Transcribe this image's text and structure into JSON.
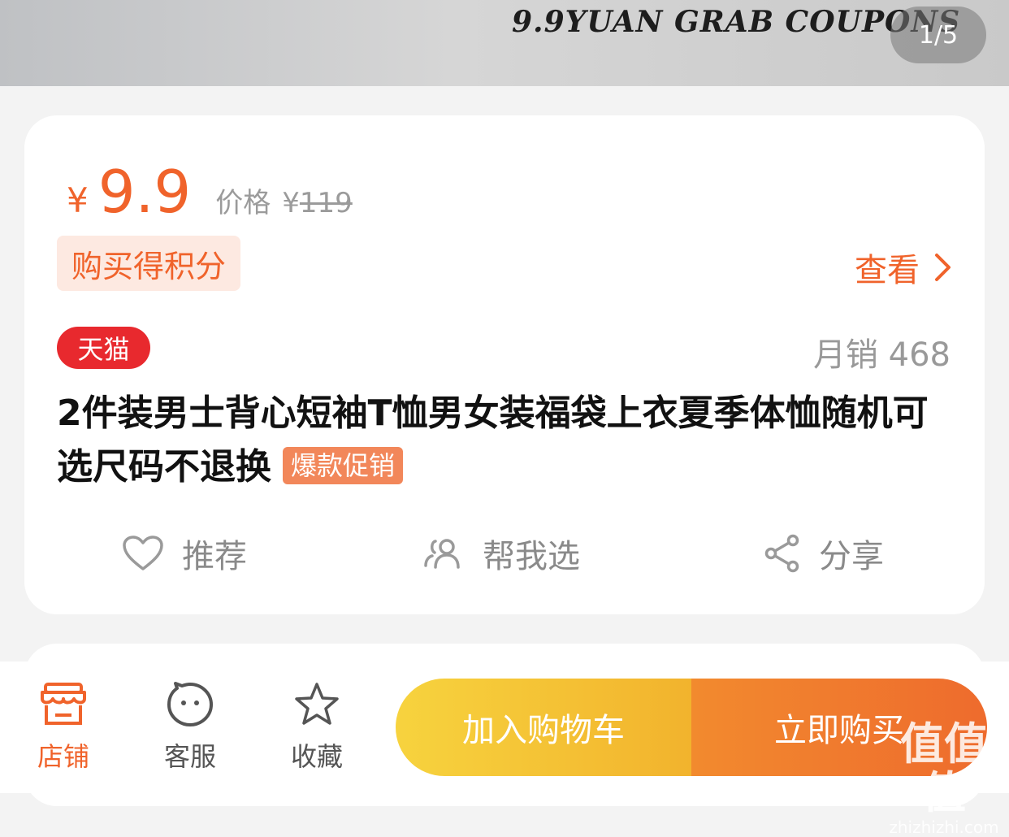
{
  "banner": {
    "text": "9.9YUAN GRAB COUPONS",
    "page_indicator": "1/5"
  },
  "price": {
    "currency": "¥",
    "current": "9.9",
    "original_label": "价格",
    "original_currency": "¥",
    "original": "119"
  },
  "points": {
    "tag": "购买得积分",
    "view_label": "查看"
  },
  "product": {
    "platform_badge": "天猫",
    "monthly_sales": "月销 468",
    "title": "2件装男士背心短袖T恤男女装福袋上衣夏季体恤随机可选尺码不退换",
    "promo_tag": "爆款促销"
  },
  "actions": {
    "recommend": "推荐",
    "help_choose": "帮我选",
    "share": "分享"
  },
  "bottom_bar": {
    "store": "店铺",
    "service": "客服",
    "favorite": "收藏",
    "add_to_cart": "加入购物车",
    "buy_now": "立即购买"
  },
  "watermark": {
    "logo": "值值值",
    "domain": "zhizhizhi.com"
  },
  "colors": {
    "accent": "#f0632b",
    "tmall_red": "#e8292e",
    "cart_yellow": "#f5c236",
    "buy_orange": "#ee6b2d"
  }
}
